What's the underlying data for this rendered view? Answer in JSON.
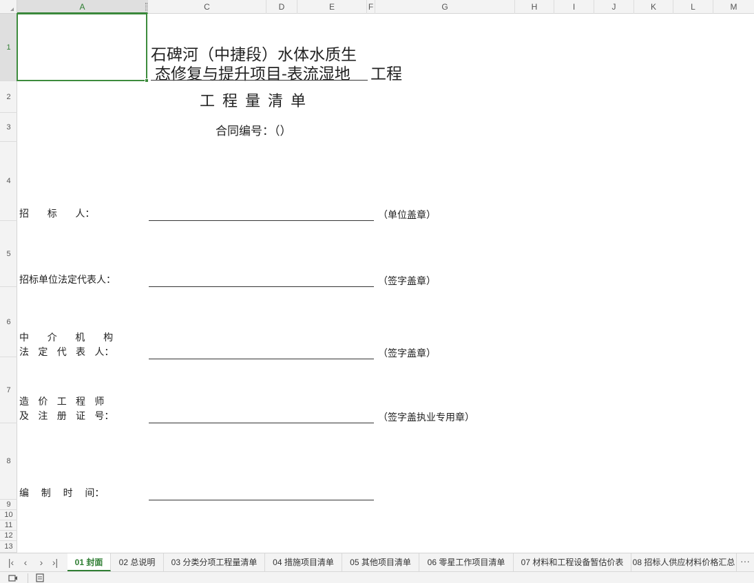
{
  "columns": [
    {
      "label": "A",
      "active": true
    },
    {
      "label": "C",
      "active": false
    },
    {
      "label": "D",
      "active": false
    },
    {
      "label": "E",
      "active": false
    },
    {
      "label": "F",
      "active": false
    },
    {
      "label": "G",
      "active": false
    },
    {
      "label": "H",
      "active": false
    },
    {
      "label": "I",
      "active": false
    },
    {
      "label": "J",
      "active": false
    },
    {
      "label": "K",
      "active": false
    },
    {
      "label": "L",
      "active": false
    },
    {
      "label": "M",
      "active": false
    }
  ],
  "rows": [
    "1",
    "2",
    "3",
    "4",
    "5",
    "6",
    "7",
    "8",
    "9",
    "10",
    "11",
    "12",
    "13"
  ],
  "document": {
    "title_line1": "石碑河（中捷段）水体水质生",
    "title_line2": "态修复与提升项目-表流湿地",
    "title_suffix": "工程",
    "subtitle": "工程量清单",
    "contract_no": "合同编号：（）"
  },
  "form": {
    "tenderer_label": "招      标      人：",
    "tenderer_note": "（单位盖章）",
    "tenderer_rep_label": "招标单位法定代表人：",
    "tenderer_rep_note": "（签字盖章）",
    "agency_label": "中      介      机      构\n法   定   代   表   人：",
    "agency_note": "（签字盖章）",
    "cost_engineer_label": "造   价   工   程   师\n及   注   册   证   号：",
    "cost_engineer_note": "（签字盖执业专用章）",
    "date_label": "编    制    时    间："
  },
  "tabs": [
    {
      "label": "01 封面",
      "active": true
    },
    {
      "label": "02 总说明",
      "active": false
    },
    {
      "label": "03 分类分项工程量清单",
      "active": false
    },
    {
      "label": "04 措施项目清单",
      "active": false
    },
    {
      "label": "05 其他项目清单",
      "active": false
    },
    {
      "label": "06 零星工作项目清单",
      "active": false
    },
    {
      "label": "07 材料和工程设备暂估价表",
      "active": false
    },
    {
      "label": "08 招标人供应材料价格汇总",
      "active": false
    }
  ],
  "tab_more": "···",
  "nav": {
    "first": "|‹",
    "prev": "‹",
    "next": "›",
    "last": "›|"
  },
  "icons": {
    "corner": "select-all-corner-icon",
    "first": "first-sheet-icon",
    "prev": "prev-sheet-icon",
    "next": "next-sheet-icon",
    "last": "last-sheet-icon",
    "more": "more-sheets-icon",
    "status1": "macro-record-icon",
    "status2": "sheet-view-icon"
  },
  "accent_color": "#2e7d32"
}
